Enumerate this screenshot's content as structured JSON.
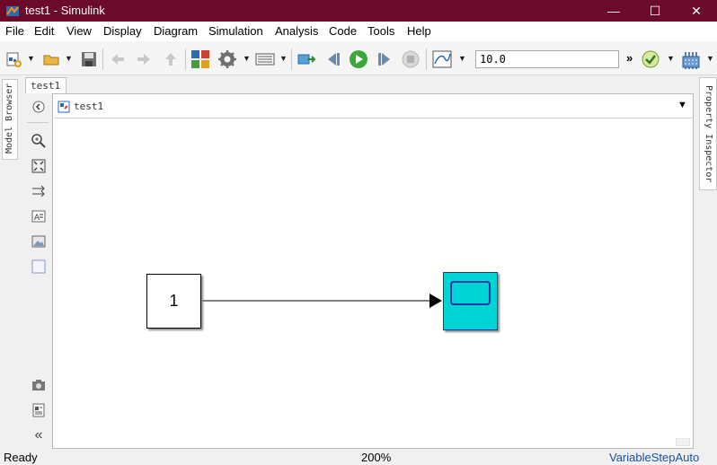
{
  "window": {
    "title": "test1 - Simulink",
    "minimize_glyph": "—",
    "maximize_glyph": "☐",
    "close_glyph": "✕",
    "titlebar_color": "#6b0a2b"
  },
  "menu": {
    "file": "File",
    "edit": "Edit",
    "view": "View",
    "display": "Display",
    "diagram": "Diagram",
    "simulation": "Simulation",
    "analysis": "Analysis",
    "code": "Code",
    "tools": "Tools",
    "help": "Help"
  },
  "toolbar": {
    "stop_time": "10.0",
    "more_glyph": "»",
    "icons": [
      "new-model-icon",
      "open-icon",
      "save-icon",
      "back-icon",
      "forward-icon",
      "up-icon",
      "library-browser-icon",
      "model-settings-icon",
      "model-configuration-icon",
      "step-back-icon",
      "run-icon",
      "step-forward-icon",
      "stop-icon",
      "scope-icon",
      "check-icon",
      "compile-icon"
    ]
  },
  "side_tabs": {
    "model_browser": "Model Browser",
    "property_inspector": "Property Inspector"
  },
  "editor": {
    "tab_label": "test1",
    "breadcrumb": "test1",
    "collapse_glyph": "«"
  },
  "diagram": {
    "constant_value": "1",
    "scope_color": "#00d4d4"
  },
  "status": {
    "state": "Ready",
    "zoom": "200%",
    "solver": "VariableStepAuto",
    "solver_color": "#1a50a0"
  }
}
